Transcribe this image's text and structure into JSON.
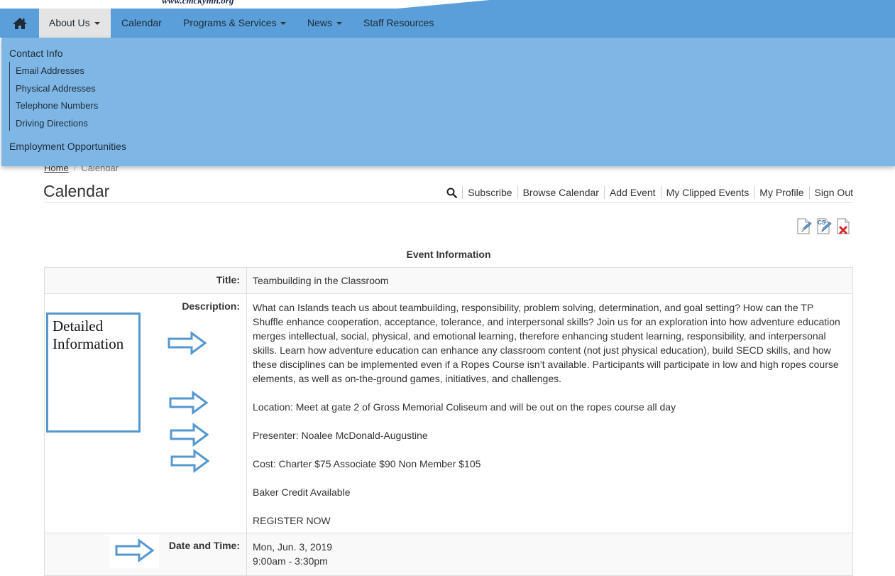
{
  "banner": {
    "url": "www.cmckymn.org"
  },
  "nav": {
    "items": [
      {
        "label": "About Us",
        "dropdown": true
      },
      {
        "label": "Calendar",
        "dropdown": false
      },
      {
        "label": "Programs & Services",
        "dropdown": true
      },
      {
        "label": "News",
        "dropdown": true
      },
      {
        "label": "Staff Resources",
        "dropdown": false
      }
    ],
    "home_icon": "home-icon"
  },
  "dropdown": {
    "contact_heading": "Contact Info",
    "contact_items": [
      "Email Addresses",
      "Physical Addresses",
      "Telephone Numbers",
      "Driving Directions"
    ],
    "employment": "Employment Opportunities"
  },
  "breadcrumb": {
    "home": "Home",
    "separator": "/",
    "current": "Calendar"
  },
  "page": {
    "title": "Calendar"
  },
  "toolbar": {
    "search_icon": "search-icon",
    "links": [
      "Subscribe",
      "Browse Calendar",
      "Add Event",
      "My Clipped Events",
      "My Profile",
      "Sign Out"
    ]
  },
  "doc_icons": [
    "edit-document-icon",
    "copy-document-icon",
    "delete-document-icon"
  ],
  "event": {
    "heading": "Event Information",
    "title_label": "Title:",
    "title": "Teambuilding in the Classroom",
    "description_label": "Description:",
    "description": [
      "What can Islands teach us about teambuilding, responsibility, problem solving, determination, and goal setting? How can the TP Shuffle enhance cooperation, acceptance, tolerance, and interpersonal skills? Join us for an exploration into how adventure education merges intellectual, social, physical, and emotional learning, therefore enhancing student learning, responsibility, and interpersonal skills. Learn how adventure education can enhance any classroom content (not just physical education), build SECD skills, and how these disciplines can be implemented even if a Ropes Course isn’t available. Participants will participate in low and high ropes course elements, as well as on-the-ground games, initiatives, and challenges.",
      "Location: Meet at gate 2 of Gross Memorial Coliseum and will be out on the ropes course all day",
      "Presenter: Noalee McDonald-Augustine",
      "Cost: Charter $75 Associate $90 Non Member $105",
      "Baker Credit Available",
      "REGISTER NOW"
    ],
    "date_label": "Date and Time:",
    "date": "Mon, Jun. 3, 2019",
    "time": "9:00am -  3:30pm"
  },
  "annotation": {
    "box_text_line1": "Detailed",
    "box_text_line2": "Information",
    "color": "#5597cf"
  },
  "colors": {
    "navbar": "#5a9fd9",
    "dropdown": "#7eb7e6",
    "nav_active": "#e4e4e4"
  }
}
